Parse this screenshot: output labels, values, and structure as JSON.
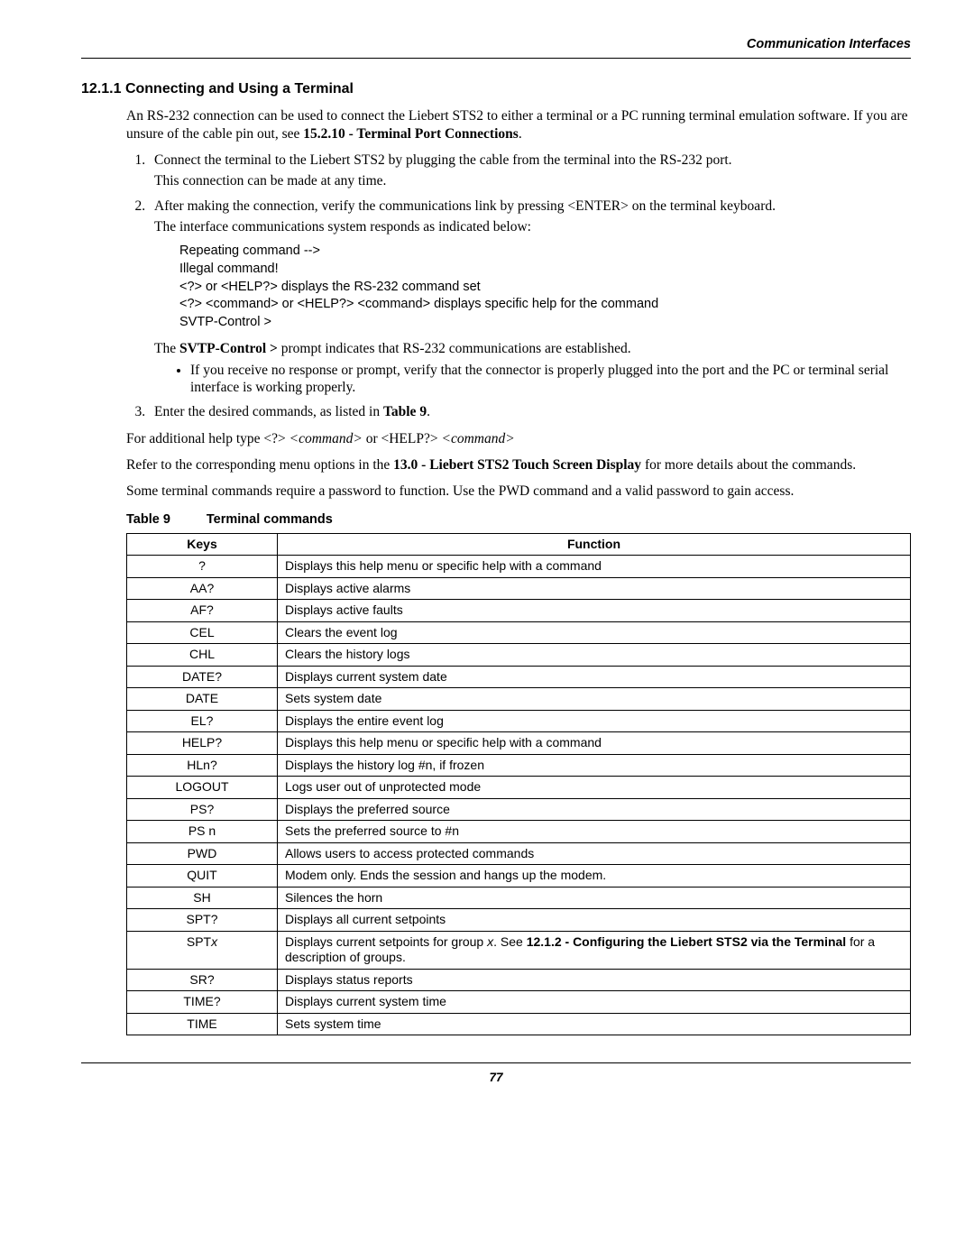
{
  "header": {
    "section": "Communication Interfaces"
  },
  "heading": {
    "number": "12.1.1",
    "title": "Connecting and Using a Terminal"
  },
  "intro": {
    "p1_a": "An RS-232 connection can be used to connect the Liebert STS2 to either a terminal or a PC running terminal emulation software. If you are unsure of the cable pin out, see ",
    "p1_bold": "15.2.10 - Terminal Port Connections",
    "p1_b": "."
  },
  "step1": {
    "line1": "Connect the terminal to the Liebert STS2 by plugging the cable from the terminal into the RS-232 port.",
    "line2": "This connection can be made at any time."
  },
  "step2": {
    "line1": "After making the connection, verify the communications link by pressing <ENTER> on the terminal keyboard.",
    "line2": "The interface communications system responds as indicated below:",
    "code": "Repeating command -->\nIllegal command!\n<?> or <HELP?> displays the RS-232 command set\n<?> <command> or <HELP?> <command> displays specific help for the command\nSVTP-Control >",
    "after_a": "The ",
    "after_bold": "SVTP-Control >",
    "after_b": " prompt indicates that RS-232 communications are established.",
    "bullet": "If you receive no response or prompt, verify that the connector is properly plugged into the port and the PC or terminal serial interface is working properly."
  },
  "step3": {
    "line1_a": "Enter the desired commands, as listed in ",
    "line1_bold": "Table 9",
    "line1_b": "."
  },
  "post": {
    "p1_a": "For additional help type <?> ",
    "p1_i1": "<command>",
    "p1_b": " or <HELP?> ",
    "p1_i2": "<command>",
    "p2_a": "Refer to the corresponding menu options in the ",
    "p2_bold": "13.0 - Liebert STS2 Touch Screen Display",
    "p2_b": " for more details about the commands.",
    "p3": "Some terminal commands require a password to function. Use the PWD command and a valid password to gain access."
  },
  "table": {
    "caption_a": "Table 9",
    "caption_b": "Terminal commands",
    "head_keys": "Keys",
    "head_func": "Function",
    "rows": [
      {
        "key": "?",
        "func_plain": "Displays this help menu or specific help with a command"
      },
      {
        "key": "AA?",
        "func_plain": "Displays active alarms"
      },
      {
        "key": "AF?",
        "func_plain": "Displays active faults"
      },
      {
        "key": "CEL",
        "func_plain": "Clears the event log"
      },
      {
        "key": "CHL",
        "func_plain": "Clears the history logs"
      },
      {
        "key": "DATE?",
        "func_plain": "Displays current system date"
      },
      {
        "key": "DATE",
        "func_plain": "Sets system date"
      },
      {
        "key": "EL?",
        "func_plain": "Displays the entire event log"
      },
      {
        "key": "HELP?",
        "func_plain": "Displays this help menu or specific help with a command"
      },
      {
        "key": "HLn?",
        "func_plain": "Displays the history log #n, if frozen"
      },
      {
        "key": "LOGOUT",
        "func_plain": "Logs user out of unprotected mode"
      },
      {
        "key": "PS?",
        "func_plain": "Displays the preferred source"
      },
      {
        "key": "PS n",
        "func_plain": "Sets the preferred source to #n"
      },
      {
        "key": "PWD",
        "func_plain": "Allows users to access protected commands"
      },
      {
        "key": "QUIT",
        "func_plain": "Modem only. Ends the session and hangs up the modem."
      },
      {
        "key": "SH",
        "func_plain": "Silences the horn"
      },
      {
        "key": "SPT?",
        "func_plain": "Displays all current setpoints"
      },
      {
        "key_html": "SPT<i>x</i>",
        "func_html": "Displays current setpoints for group <i>x</i>. See <b>12.1.2 - Configuring the Liebert STS2 via the Terminal</b> for a description of groups."
      },
      {
        "key": "SR?",
        "func_plain": "Displays status reports"
      },
      {
        "key": "TIME?",
        "func_plain": "Displays current system time"
      },
      {
        "key": "TIME",
        "func_plain": "Sets system time"
      }
    ]
  },
  "page": "77"
}
